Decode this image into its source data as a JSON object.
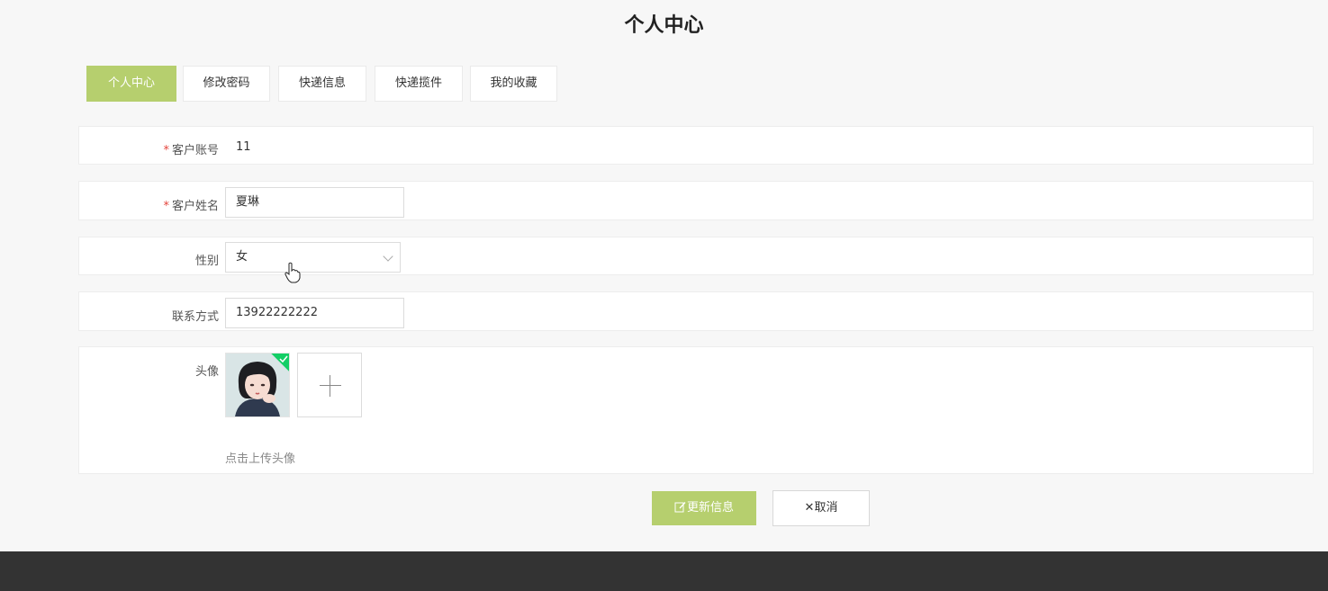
{
  "page": {
    "title": "个人中心"
  },
  "tabs": [
    {
      "label": "个人中心",
      "active": true
    },
    {
      "label": "修改密码"
    },
    {
      "label": "快递信息"
    },
    {
      "label": "快递揽件"
    },
    {
      "label": "我的收藏"
    }
  ],
  "form": {
    "account": {
      "required_mark": "*",
      "label": "客户账号",
      "value": "11"
    },
    "name": {
      "required_mark": "*",
      "label": "客户姓名",
      "value": "夏琳"
    },
    "gender": {
      "label": "性别",
      "value": "女"
    },
    "phone": {
      "label": "联系方式",
      "value": "13922222222"
    },
    "avatar": {
      "label": "头像",
      "hint": "点击上传头像"
    }
  },
  "actions": {
    "update_label": "更新信息",
    "cancel_label": "取消"
  },
  "colors": {
    "accent": "#b6cf6e",
    "footer": "#333333",
    "required": "#e4443c",
    "upload_success": "#13ce66"
  },
  "icons": {
    "edit": "edit-icon",
    "close": "close-icon",
    "plus": "plus-icon",
    "check": "check-icon",
    "chevron": "chevron-down-icon"
  }
}
